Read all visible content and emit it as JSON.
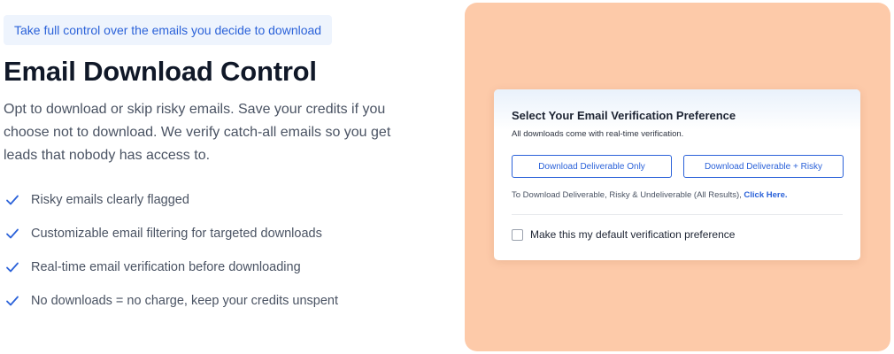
{
  "left": {
    "eyebrow": "Take full control over the emails you decide to download",
    "title": "Email Download Control",
    "description": "Opt to download or skip risky emails. Save your credits if you choose not to download. We verify catch-all emails so you get leads that nobody has access to.",
    "features": [
      {
        "label": "Risky emails clearly flagged",
        "icon": "check-icon"
      },
      {
        "label": "Customizable email filtering for targeted downloads",
        "icon": "check-icon"
      },
      {
        "label": "Real-time email verification before downloading",
        "icon": "check-icon"
      },
      {
        "label": "No downloads = no charge, keep your credits unspent",
        "icon": "check-icon"
      }
    ]
  },
  "card": {
    "title": "Select Your Email Verification Preference",
    "subtitle": "All downloads come with real-time verification.",
    "buttons": {
      "deliverable_only": "Download Deliverable Only",
      "deliverable_risky": "Download Deliverable + Risky"
    },
    "all_results_text": "To Download Deliverable, Risky & Undeliverable (All Results), ",
    "all_results_link": "Click Here.",
    "default_preference_label": "Make this my default verification preference"
  },
  "colors": {
    "accent": "#2b62d9",
    "panel_background": "#fdcaa9",
    "eyebrow_background": "#eef4fd",
    "heading": "#101828",
    "body_text": "#4a5363"
  }
}
